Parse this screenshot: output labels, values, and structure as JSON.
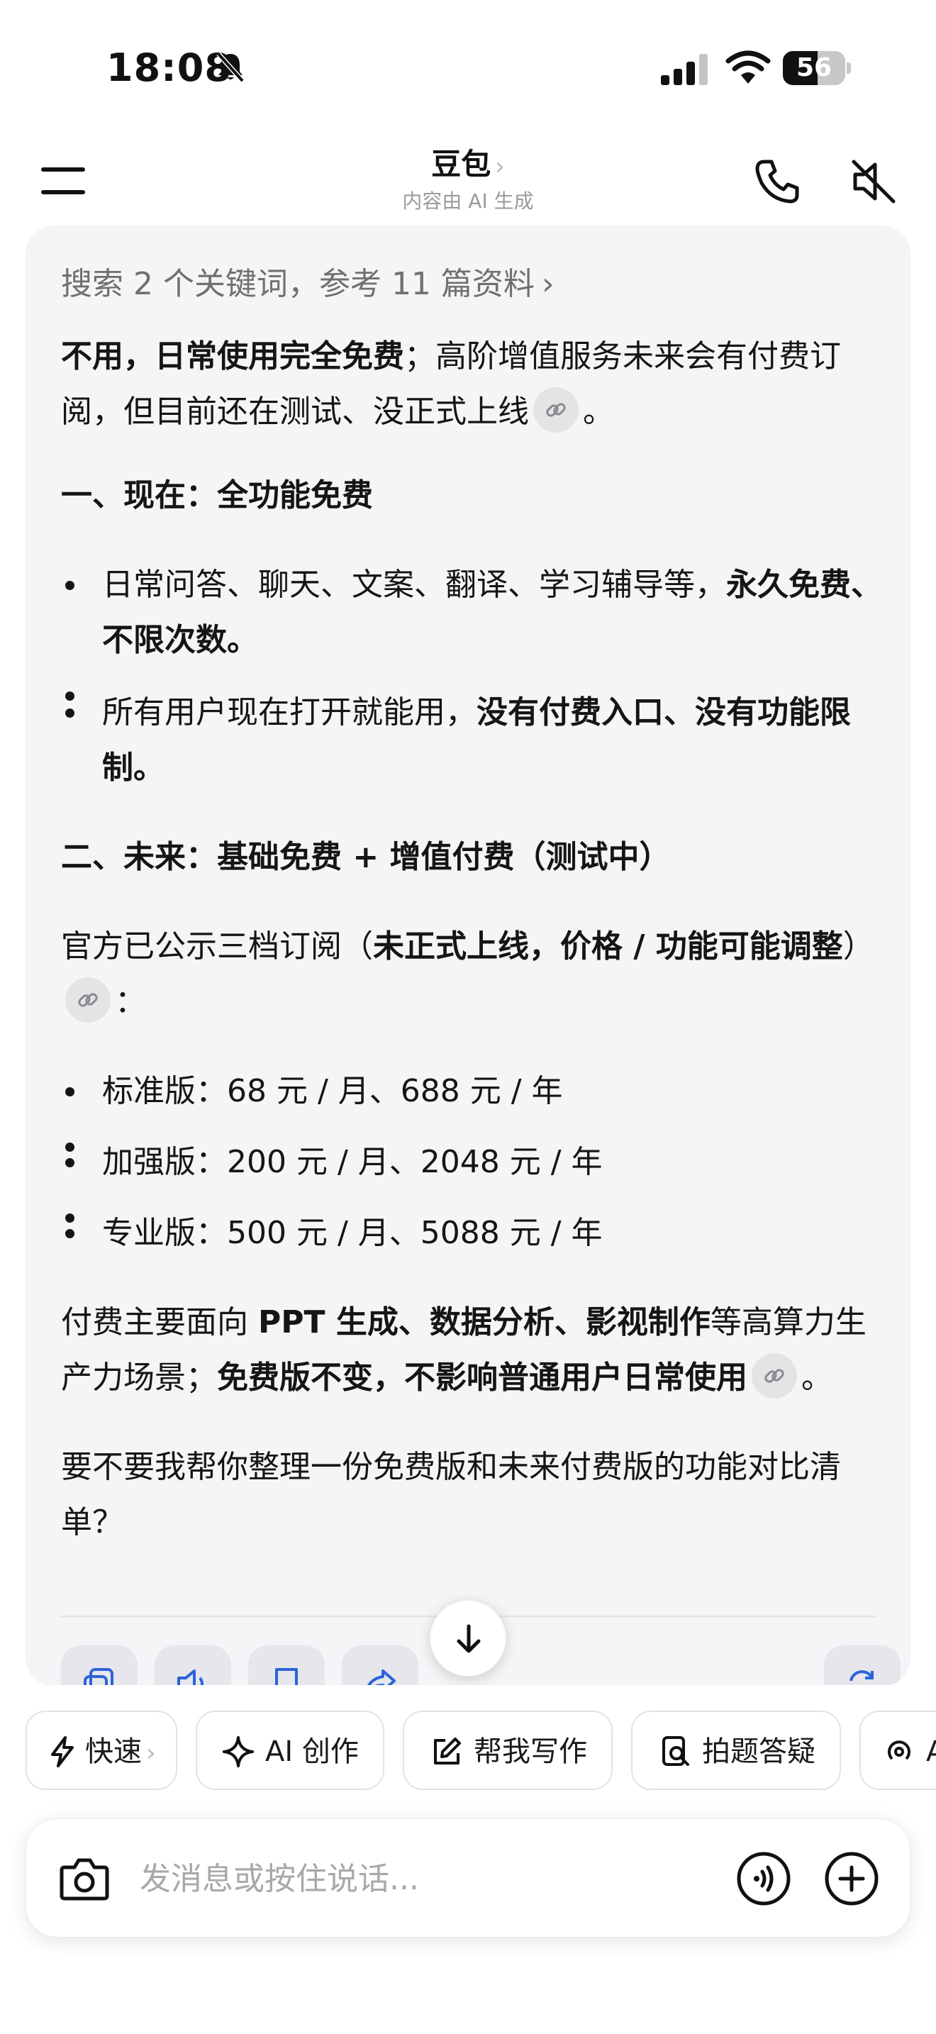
{
  "status_bar": {
    "time": "18:08",
    "battery_level": "56",
    "battery_fraction": 0.56
  },
  "header": {
    "title": "豆包",
    "title_chevron": "›",
    "subtitle": "内容由 AI 生成"
  },
  "message": {
    "search_ref": "搜索 2 个关键词，参考 11 篇资料",
    "search_ref_chevron": "›",
    "intro_bold": "不用，日常使用完全免费",
    "intro_rest": "；高阶增值服务未来会有付费订阅，但目前还在测试、没正式上线",
    "intro_end": "。",
    "section1_title": "一、现在：全功能免费",
    "s1_item1_text": "日常问答、聊天、文案、翻译、学习辅导等，",
    "s1_item1_bold": "永久免费、不限次数。",
    "s1_item2_text": "所有用户现在打开就能用，",
    "s1_item2_bold": "没有付费入口、没有功能限制。",
    "section2_title": "二、未来：基础免费 + 增值付费（测试中）",
    "para2_text": "官方已公示三档订阅（",
    "para2_bold": "未正式上线，价格 / 功能可能调整",
    "para2_close": "）",
    "para2_end": "：",
    "plans": [
      {
        "label": "标准版：",
        "price": "68 元 / 月、688 元 / 年"
      },
      {
        "label": "加强版：",
        "price": "200 元 / 月、2048 元 / 年"
      },
      {
        "label": "专业版：",
        "price": "500 元 / 月、5088 元 / 年"
      }
    ],
    "para3_a": "付费主要面向 ",
    "para3_b": "PPT 生成、数据分析、影视制作",
    "para3_c": "等高算力生产力场景；",
    "para3_d": "免费版不变，不影响普通用户日常使用",
    "para3_end": "。",
    "question": "要不要我帮你整理一份免费版和未来付费版的功能对比清单？"
  },
  "quick_actions": {
    "fast": "快速",
    "fast_chevron": "›",
    "ai_create": "AI 创作",
    "help_write": "帮我写作",
    "photo_qa": "拍题答疑",
    "partial": "A"
  },
  "input": {
    "placeholder": "发消息或按住说话..."
  },
  "icons": {
    "menu": "menu-icon",
    "phone": "phone-icon",
    "speaker_off": "speaker-off-icon",
    "link": "link-icon",
    "copy": "copy-icon",
    "read_aloud": "speaker-icon",
    "bookmark": "bookmark-icon",
    "share": "share-icon",
    "regenerate": "refresh-icon",
    "scroll_down": "arrow-down-icon",
    "lightning": "lightning-icon",
    "sparkle": "sparkle-icon",
    "edit": "edit-icon",
    "photo_search": "photo-search-icon",
    "broadcast": "broadcast-icon",
    "camera": "camera-icon",
    "voice": "voice-icon",
    "plus": "plus-icon"
  }
}
